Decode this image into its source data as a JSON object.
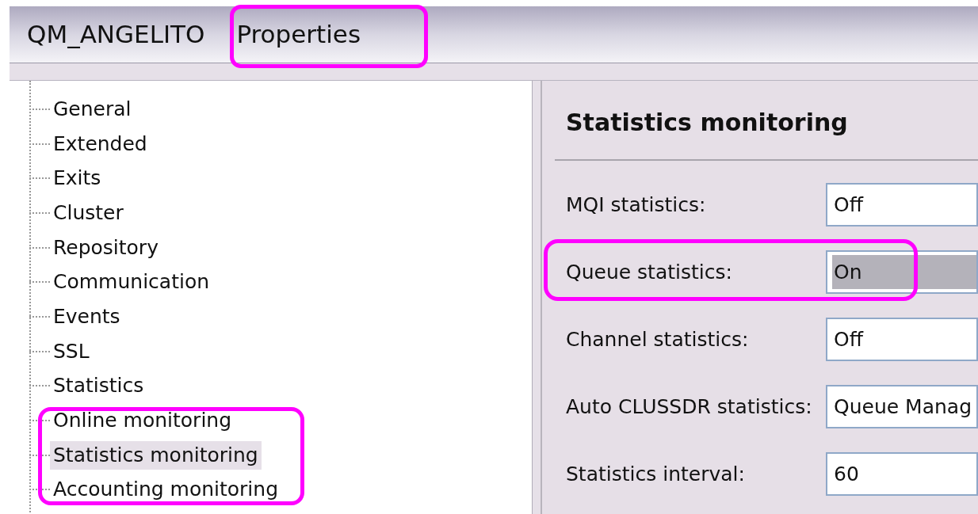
{
  "window": {
    "title_parts": [
      "QM_ANGELITO",
      "Properties"
    ]
  },
  "tree": {
    "items": [
      {
        "label": "General",
        "selected": false
      },
      {
        "label": "Extended",
        "selected": false
      },
      {
        "label": "Exits",
        "selected": false
      },
      {
        "label": "Cluster",
        "selected": false
      },
      {
        "label": "Repository",
        "selected": false
      },
      {
        "label": "Communication",
        "selected": false
      },
      {
        "label": "Events",
        "selected": false
      },
      {
        "label": "SSL",
        "selected": false
      },
      {
        "label": "Statistics",
        "selected": false
      },
      {
        "label": "Online monitoring",
        "selected": false
      },
      {
        "label": "Statistics monitoring",
        "selected": true
      },
      {
        "label": "Accounting monitoring",
        "selected": false
      }
    ]
  },
  "panel": {
    "heading": "Statistics monitoring",
    "fields": [
      {
        "label": "MQI statistics:",
        "value": "Off",
        "selected": false
      },
      {
        "label": "Queue statistics:",
        "value": "On",
        "selected": true
      },
      {
        "label": "Channel statistics:",
        "value": "Off",
        "selected": false
      },
      {
        "label": "Auto CLUSSDR statistics:",
        "value": "Queue Manag",
        "selected": false
      },
      {
        "label": "Statistics interval:",
        "value": "60",
        "selected": false
      }
    ]
  }
}
